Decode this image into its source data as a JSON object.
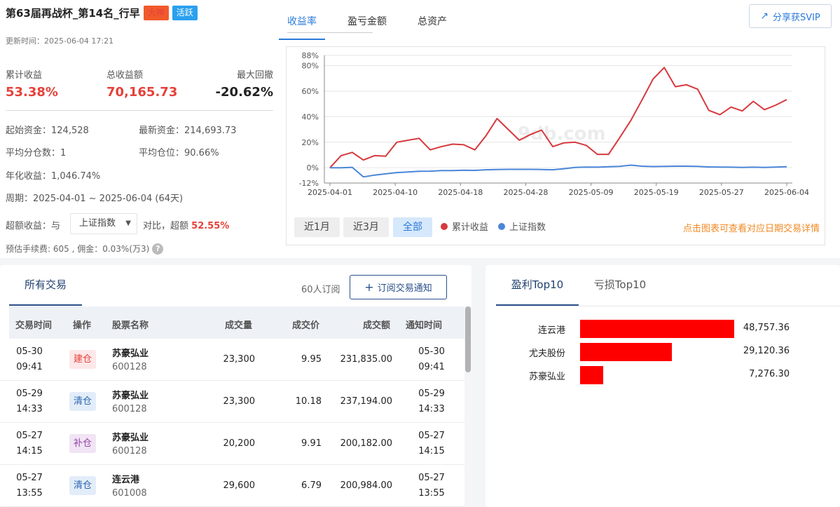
{
  "header": {
    "title": "第63届再战杯_第14名_行早",
    "badge1": "大神",
    "badge2": "活跃",
    "update_time": "更新时间：2025-06-04 17:21",
    "share_label": "分享获SVIP"
  },
  "summary": {
    "cum_return_label": "累计收益",
    "cum_return": "53.38%",
    "total_profit_label": "总收益额",
    "total_profit": "70,165.73",
    "max_dd_label": "最大回撤",
    "max_dd": "-20.62%"
  },
  "details": {
    "start_capital": "起始资金：124,528",
    "latest_capital": "最新资金：214,693.73",
    "avg_split": "平均分仓数：1",
    "avg_position": "平均仓位：90.66%",
    "annual": "年化收益：1,046.74%",
    "period": "周期：2025-04-01 ~ 2025-06-04 (64天)",
    "excess_prefix": "超额收益：与",
    "benchmark_select": "上证指数",
    "excess_mid": "对比，超额",
    "excess_value": "52.55%",
    "fee": "预估手续费: 605 , 佣金：0.03%(万3)"
  },
  "chart_tabs": [
    "收益率",
    "盈亏金额",
    "总资产"
  ],
  "range_buttons": [
    "近1月",
    "近3月",
    "全部"
  ],
  "chart_hint": "点击图表可查看对应日期交易详情",
  "watermark": "9db.com",
  "chart_data": {
    "type": "line",
    "x_ticks": [
      "2025-04-01",
      "2025-04-10",
      "2025-04-18",
      "2025-04-28",
      "2025-05-09",
      "2025-05-19",
      "2025-05-27",
      "2025-06-04"
    ],
    "y_ticks": [
      "88%",
      "80%",
      "60%",
      "40%",
      "20%",
      "0%",
      "-12%"
    ],
    "ylim": [
      -12,
      88
    ],
    "grid": true,
    "legend_position": "bottom",
    "series": [
      {
        "name": "累计收益",
        "color": "#d7393d",
        "values": [
          0,
          9.5,
          12,
          6,
          9.5,
          9,
          20,
          21.5,
          23,
          14,
          16.5,
          18.5,
          18,
          14,
          25,
          38.5,
          30,
          21.5,
          26,
          29.5,
          16.5,
          19.5,
          20,
          17.5,
          10.5,
          10.5,
          23.5,
          37,
          53,
          69.5,
          78.5,
          63.5,
          65,
          61.5,
          45,
          41.5,
          47.5,
          44.5,
          52,
          45.5,
          49,
          53.4
        ]
      },
      {
        "name": "上证指数",
        "color": "#4a86d8",
        "values": [
          0,
          0,
          0.3,
          -7.2,
          -5.8,
          -4.8,
          -3.8,
          -3.3,
          -2.8,
          -2.7,
          -2.2,
          -2.2,
          -2.0,
          -2.1,
          -1.6,
          -1.4,
          -1.3,
          -1.3,
          -1.3,
          -1.4,
          -1.6,
          -0.8,
          0.2,
          0.5,
          0.4,
          0.8,
          1.0,
          2.0,
          1.2,
          0.9,
          1.0,
          1.2,
          1.2,
          1.0,
          0.6,
          0.5,
          0.4,
          0.2,
          0.4,
          0.2,
          0.5,
          0.8
        ]
      }
    ]
  },
  "trades": {
    "tab_label": "所有交易",
    "subscribers": "60人订阅",
    "subscribe_label": "订阅交易通知",
    "columns": [
      "交易时间",
      "操作",
      "股票名称",
      "成交量",
      "成交价",
      "成交额",
      "通知时间"
    ],
    "rows": [
      {
        "date": "05-30",
        "time": "09:41",
        "op": "建仓",
        "op_type": "build",
        "name": "苏豪弘业",
        "code": "600128",
        "volume": "23,300",
        "price": "9.95",
        "amount": "231,835.00",
        "n_date": "05-30",
        "n_time": "09:41"
      },
      {
        "date": "05-29",
        "time": "14:33",
        "op": "清仓",
        "op_type": "clear",
        "name": "苏豪弘业",
        "code": "600128",
        "volume": "23,300",
        "price": "10.18",
        "amount": "237,194.00",
        "n_date": "05-29",
        "n_time": "14:33"
      },
      {
        "date": "05-27",
        "time": "14:15",
        "op": "补仓",
        "op_type": "add",
        "name": "苏豪弘业",
        "code": "600128",
        "volume": "20,200",
        "price": "9.91",
        "amount": "200,182.00",
        "n_date": "05-27",
        "n_time": "14:15"
      },
      {
        "date": "05-27",
        "time": "13:55",
        "op": "清仓",
        "op_type": "clear",
        "name": "连云港",
        "code": "601008",
        "volume": "29,600",
        "price": "6.79",
        "amount": "200,984.00",
        "n_date": "05-27",
        "n_time": "13:55"
      }
    ]
  },
  "top10": {
    "tab_profit": "盈利Top10",
    "tab_loss": "亏损Top10",
    "bar_color": "#ff0000",
    "items": [
      {
        "name": "连云港",
        "value": 48757.36,
        "label": "48,757.36"
      },
      {
        "name": "尤夫股份",
        "value": 29120.36,
        "label": "29,120.36"
      },
      {
        "name": "苏豪弘业",
        "value": 7276.3,
        "label": "7,276.30"
      }
    ]
  }
}
